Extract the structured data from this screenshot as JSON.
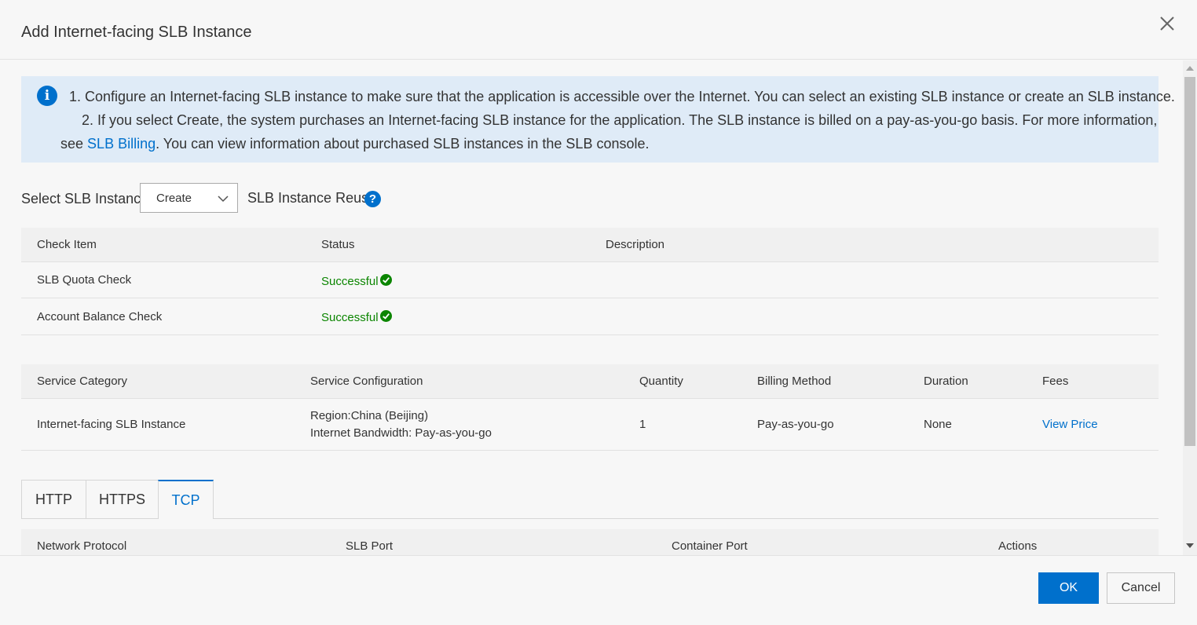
{
  "dialog": {
    "title": "Add Internet-facing SLB Instance"
  },
  "notice": {
    "line1": "1. Configure an Internet-facing SLB instance to make sure that the application is accessible over the Internet. You can select an existing SLB instance or create an SLB instance.",
    "line2": "2. If you select Create, the system purchases an Internet-facing SLB instance for the application. The SLB instance is billed on a pay-as-you-go basis. For more information,",
    "line3_prefix": "see",
    "line3_link": "SLB Billing",
    "line3_suffix": ". You can view information about purchased SLB instances in the SLB console."
  },
  "select_slb": {
    "label": "Select SLB Instance:",
    "value": "Create",
    "reuse_label": "SLB Instance Reuse",
    "help_glyph": "?"
  },
  "check_table": {
    "headers": [
      "Check Item",
      "Status",
      "Description"
    ],
    "rows": [
      {
        "item": "SLB Quota Check",
        "status": "Successful",
        "description": ""
      },
      {
        "item": "Account Balance Check",
        "status": "Successful",
        "description": ""
      }
    ]
  },
  "service_table": {
    "headers": [
      "Service Category",
      "Service Configuration",
      "Quantity",
      "Billing Method",
      "Duration",
      "Fees"
    ],
    "rows": [
      {
        "category": "Internet-facing SLB Instance",
        "config_line1": "Region:China (Beijing)",
        "config_line2": "Internet Bandwidth: Pay-as-you-go",
        "quantity": "1",
        "billing": "Pay-as-you-go",
        "duration": "None",
        "fees": "View Price"
      }
    ]
  },
  "tabs": {
    "items": [
      "HTTP",
      "HTTPS",
      "TCP"
    ],
    "active": "TCP"
  },
  "port_table": {
    "headers": [
      "Network Protocol",
      "SLB Port",
      "Container Port",
      "Actions"
    ]
  },
  "footer": {
    "ok_label": "OK",
    "cancel_label": "Cancel"
  },
  "colors": {
    "accent": "#0070cc",
    "success": "#0b8500",
    "notice_bg": "#dfebf7"
  },
  "icons": [
    "close-icon",
    "info-icon",
    "chevron-down-icon",
    "help-icon",
    "check-circle-icon"
  ]
}
